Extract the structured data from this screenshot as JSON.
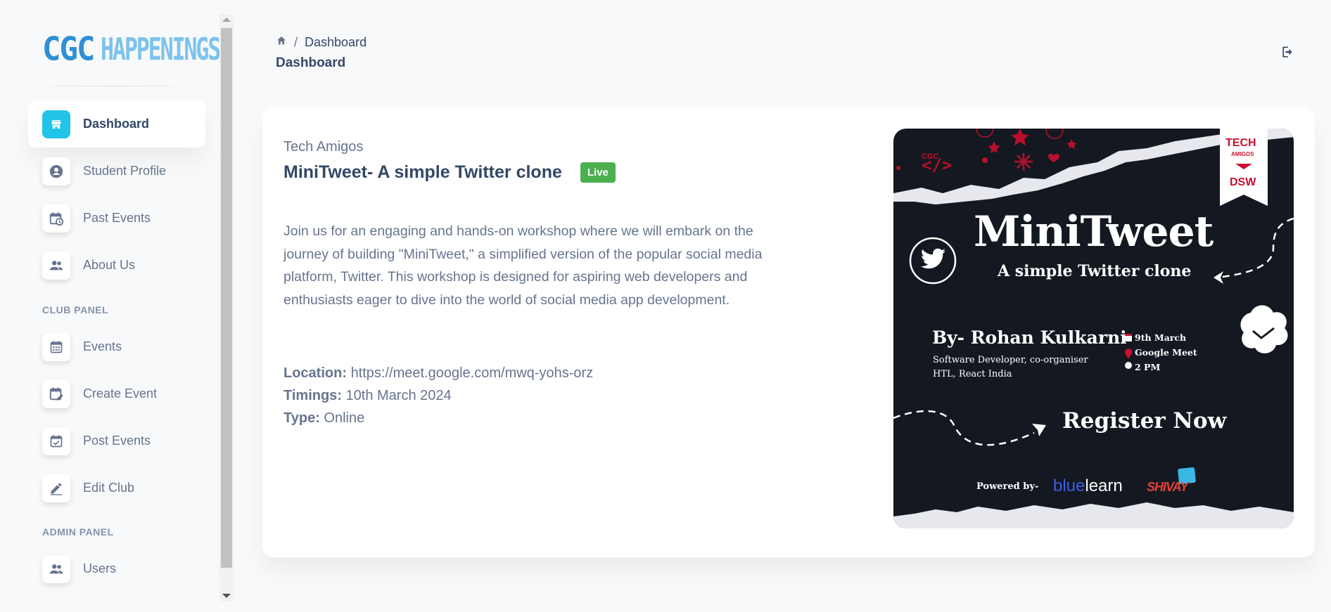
{
  "app": {
    "logo_primary": "CGC",
    "logo_secondary": "HAPPENINGS"
  },
  "sidebar": {
    "items": [
      {
        "label": "Dashboard",
        "icon": "storefront-icon",
        "active": true
      },
      {
        "label": "Student Profile",
        "icon": "account-circle-icon"
      },
      {
        "label": "Past Events",
        "icon": "calendar-history-icon"
      },
      {
        "label": "About Us",
        "icon": "people-icon"
      }
    ],
    "club_panel_title": "CLUB PANEL",
    "club_items": [
      {
        "label": "Events",
        "icon": "calendar-icon"
      },
      {
        "label": "Create Event",
        "icon": "calendar-edit-icon"
      },
      {
        "label": "Post Events",
        "icon": "calendar-check-icon"
      },
      {
        "label": "Edit Club",
        "icon": "pencil-icon"
      }
    ],
    "admin_panel_title": "ADMIN PANEL",
    "admin_items": [
      {
        "label": "Users",
        "icon": "people-icon"
      }
    ]
  },
  "header": {
    "breadcrumb_separator": "/",
    "breadcrumb_current": "Dashboard",
    "title": "Dashboard"
  },
  "event": {
    "club": "Tech Amigos",
    "title": "MiniTweet- A simple Twitter clone",
    "status": "Live",
    "description": "Join us for an engaging and hands-on workshop where we will embark on the journey of building \"MiniTweet,\" a simplified version of the popular social media platform, Twitter. This workshop is designed for aspiring web developers and enthusiasts eager to dive into the world of social media app development.",
    "location_label": "Location:",
    "location": "https://meet.google.com/mwq-yohs-orz",
    "timings_label": "Timings:",
    "timings": "10th March 2024",
    "type_label": "Type:",
    "type": "Online"
  },
  "poster": {
    "org_small": "CGC",
    "badge_top": "TECH",
    "badge_mid": "AMIGOS",
    "badge_bottom": "DSW",
    "title": "MiniTweet",
    "subtitle": "A simple Twitter clone",
    "speaker": "By- Rohan Kulkarni",
    "speaker_role_1": "Software Developer, co-organiser",
    "speaker_role_2": "HTL, React India",
    "date": "9th March",
    "platform": "Google Meet",
    "time": "2 PM",
    "cta": "Register Now",
    "powered_by": "Powered by-",
    "sponsor_1_a": "blue",
    "sponsor_1_b": "learn",
    "sponsor_2": "SHIVAY",
    "colors": {
      "background": "#141820",
      "accent_red": "#c8102e",
      "blue": "#3c5ee8"
    }
  }
}
